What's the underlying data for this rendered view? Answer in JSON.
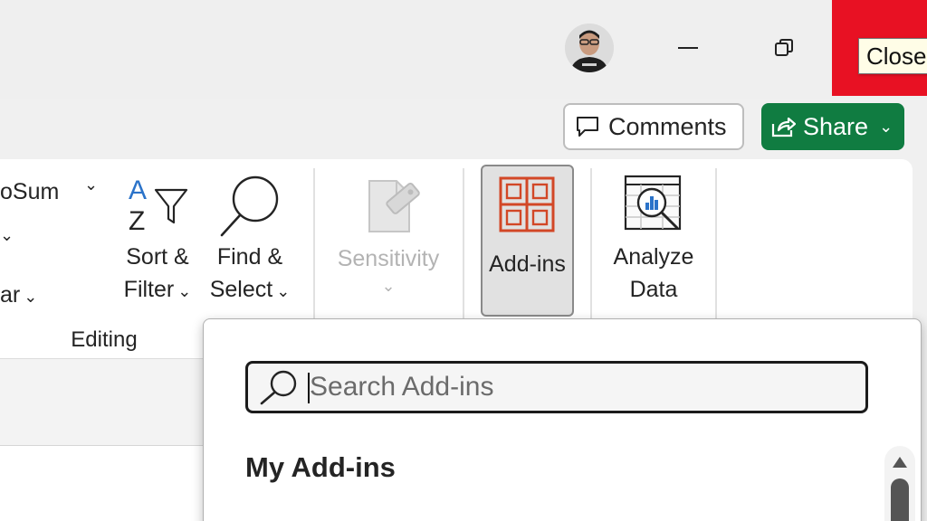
{
  "window": {
    "close_tooltip": "Close"
  },
  "header": {
    "comments_label": "Comments",
    "share_label": "Share"
  },
  "ribbon": {
    "autosum_label": "oSum",
    "clear_label": "ar",
    "sort_filter_line1": "Sort &",
    "sort_filter_line2": "Filter",
    "find_select_line1": "Find &",
    "find_select_line2": "Select",
    "editing_group_label": "Editing",
    "sensitivity_label": "Sensitivity",
    "addins_label": "Add-ins",
    "analyze_line1": "Analyze",
    "analyze_line2": "Data",
    "sort_icon_a": "A",
    "sort_icon_z": "Z"
  },
  "addins_panel": {
    "search_placeholder": "Search Add-ins",
    "my_addins_heading": "My Add-ins"
  },
  "colors": {
    "close_red": "#e81123",
    "share_green": "#107c41",
    "addins_icon_orange": "#d24726"
  },
  "icons": {
    "minimize": "minimize-icon",
    "restore": "restore-icon",
    "comment": "comment-icon",
    "share": "share-icon",
    "sort_filter": "sort-filter-icon",
    "find": "magnifier-icon",
    "sensitivity": "sensitivity-icon",
    "addins": "addins-grid-icon",
    "analyze": "analyze-data-icon"
  }
}
